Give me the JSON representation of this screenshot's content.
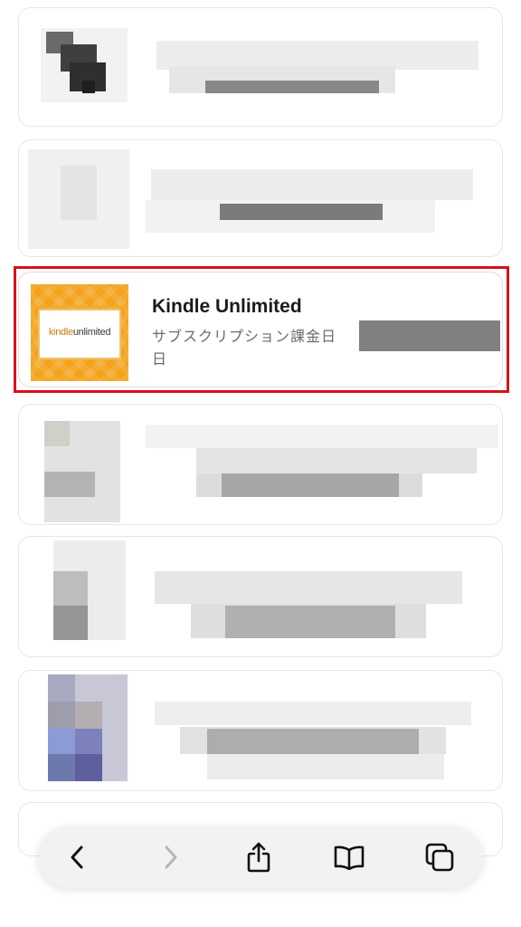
{
  "list": {
    "highlighted_item": {
      "title": "Kindle Unlimited",
      "subtitle": "サブスクリプション課金日　　　　　　 日",
      "logo_kindle": "kindle",
      "logo_unlimited": "unlimited"
    }
  },
  "toolbar": {
    "back_icon": "chevron-left-icon",
    "forward_icon": "chevron-right-icon",
    "share_icon": "share-icon",
    "bookmarks_icon": "book-icon",
    "tabs_icon": "tabs-icon"
  },
  "colors": {
    "highlight_border": "#d8111c",
    "thumbnail_orange": "#f3a21a",
    "redaction_gray": "#808080"
  }
}
